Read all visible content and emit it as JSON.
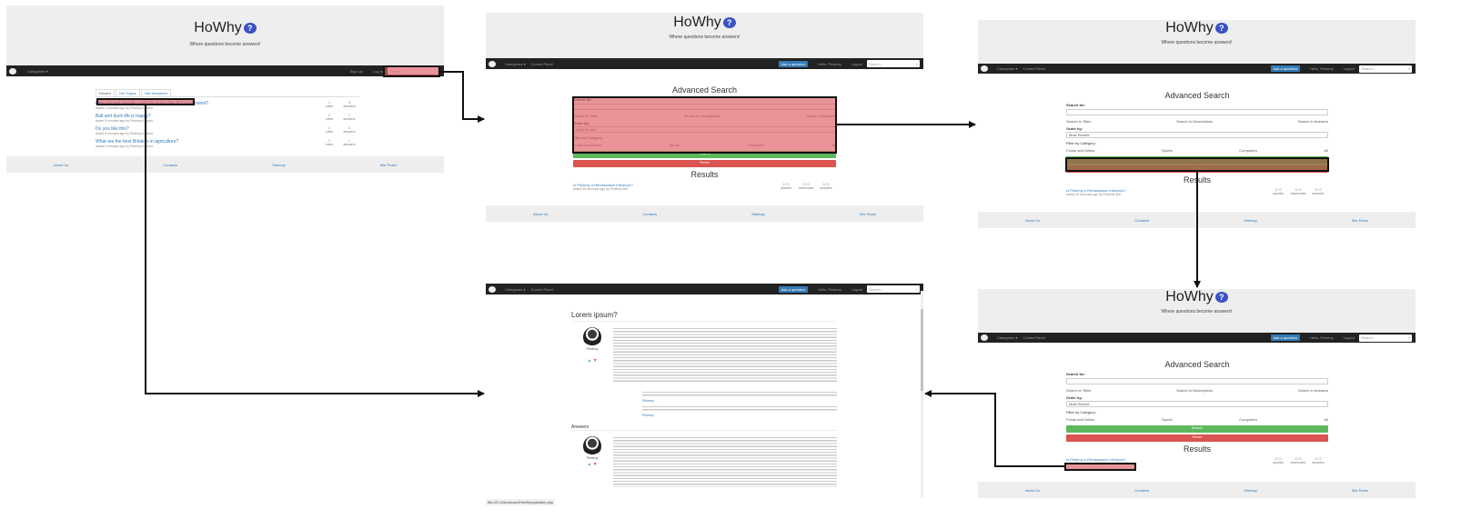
{
  "brand": {
    "name": "HoWhy",
    "badge": "?"
  },
  "tagline": "Where questions become answers!",
  "nav": {
    "categories": "Categories ▾",
    "control_panel": "Control Panel",
    "sign_up": "Sign Up",
    "log_in": "Log In",
    "ask": "Ask a question",
    "hello": "Hello, Ptolemy",
    "logout": "Logout",
    "search_placeholder": "Search..."
  },
  "home": {
    "tabs": [
      "Recent",
      "Hot Topics",
      "Not Answered"
    ],
    "questions": [
      {
        "title": "How ancient people could be giving the first movement?",
        "meta": "asked 3 minutes ago by Ptolemy Ancient",
        "votes": "4",
        "votes_label": "votes",
        "answers": "3",
        "answers_label": "answers"
      },
      {
        "title": "Bull and duck life is happy?",
        "meta": "asked 5 minutes ago by Ptolemy Ancient",
        "votes": "2",
        "votes_label": "votes",
        "answers": "1",
        "answers_label": "answers"
      },
      {
        "title": "Do you like this?",
        "meta": "asked 5 minutes ago by Ptolemy Ancient",
        "votes": "0",
        "votes_label": "votes",
        "answers": "3",
        "answers_label": "answers"
      },
      {
        "title": "What are the best Britain's in agriculture?",
        "meta": "asked 5 minutes ago by Ptolemy Ancient",
        "votes": "0",
        "votes_label": "votes",
        "answers": "1",
        "answers_label": "answers"
      }
    ]
  },
  "footer": [
    "About Us",
    "Contacts",
    "Sitemap",
    "Site Rules"
  ],
  "advanced": {
    "title": "Advanced Search",
    "search_for": "Search for:",
    "in_options": [
      "Search in Titles",
      "Search in Descriptions",
      "Search in Answers"
    ],
    "order_by": "Order by:",
    "order_value": "Most Recent",
    "filter": "Filter by Category:",
    "categories": [
      "Foods and Drinks",
      "Sports",
      "Computers",
      "All"
    ],
    "search_btn": "Search",
    "reset_btn": "Reset",
    "results_title": "Results",
    "result": {
      "title": "Is Ptolemy a Renaissance influence?",
      "meta": "asked 25 seconds ago by Ptolemy Aldi",
      "up": "2 / 0",
      "up_label": "upvotes",
      "down": "0 / 0",
      "down_label": "downvotes",
      "ans": "0 / 0",
      "ans_label": "answers"
    }
  },
  "question_page": {
    "title": "Lorem ipsum?",
    "author": "Ptolemy",
    "comment_author_1": "Ptolemy",
    "comment_author_2": "Ptolemy",
    "answers_heading": "Answers",
    "status_url": "file:///C:/Users/user/HoWhy/question.php"
  },
  "colors": {
    "jumbotron": "#eeeeee",
    "navbar": "#222222",
    "primary": "#337ab7",
    "success": "#5cb85c",
    "danger": "#d9534f",
    "highlight_red": "#db5a62",
    "highlight_brown": "#966e46"
  }
}
